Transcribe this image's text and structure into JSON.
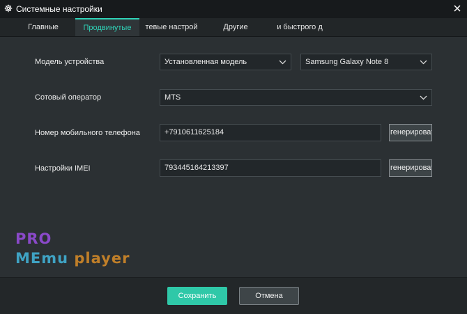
{
  "window": {
    "title": "Системные настройки",
    "icon": "gear-icon"
  },
  "tabs": [
    {
      "label": "Главные",
      "active": false
    },
    {
      "label": "Продвинутые",
      "active": true
    },
    {
      "label": "тевые настрой",
      "active": false
    },
    {
      "label": "Другие",
      "active": false
    },
    {
      "label": "и быстрого д",
      "active": false
    }
  ],
  "settings": {
    "device_model": {
      "label": "Модель устройства",
      "type_value": "Установленная модель",
      "model_value": "Samsung Galaxy Note 8"
    },
    "carrier": {
      "label": "Сотовый оператор",
      "value": "MTS"
    },
    "phone": {
      "label": "Номер мобильного телефона",
      "value": "+7910611625184",
      "generate_label": "генерироват"
    },
    "imei": {
      "label": "Настройки IMEI",
      "value": "793445164213397",
      "generate_label": "генерироват"
    }
  },
  "watermark": {
    "line1": "PRO",
    "line2_a": "MEmu",
    "line2_b": "player"
  },
  "footer": {
    "save_label": "Сохранить",
    "cancel_label": "Отмена"
  },
  "colors": {
    "accent": "#2fd3b7",
    "save_button": "#2fc8a8",
    "background": "#2b3033",
    "titlebar": "#171a1c"
  }
}
